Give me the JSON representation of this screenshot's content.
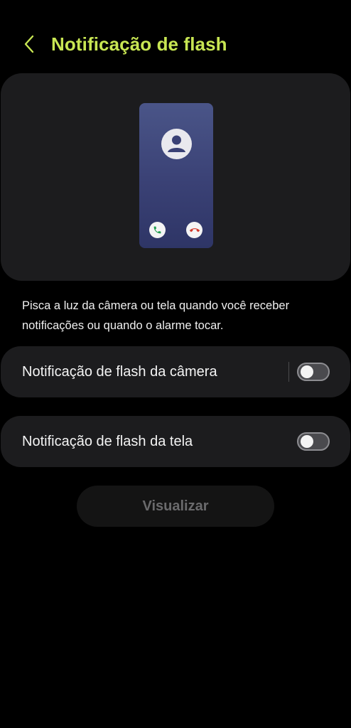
{
  "header": {
    "title": "Notificação de flash",
    "back_icon": "chevron-left-icon"
  },
  "preview": {
    "avatar_icon": "person-icon",
    "accept_icon": "phone-accept-icon",
    "decline_icon": "phone-decline-icon"
  },
  "description": "Pisca a luz da câmera ou tela quando você receber notificações ou quando o alarme tocar.",
  "settings": [
    {
      "label": "Notificação de flash da câmera",
      "enabled": false
    },
    {
      "label": "Notificação de flash da tela",
      "enabled": false
    }
  ],
  "preview_button": {
    "label": "Visualizar",
    "enabled": false
  },
  "colors": {
    "accent": "#c8e653",
    "background": "#000000",
    "card": "#1c1c1e",
    "accept": "#1f9d4e",
    "decline": "#d23a2c"
  }
}
